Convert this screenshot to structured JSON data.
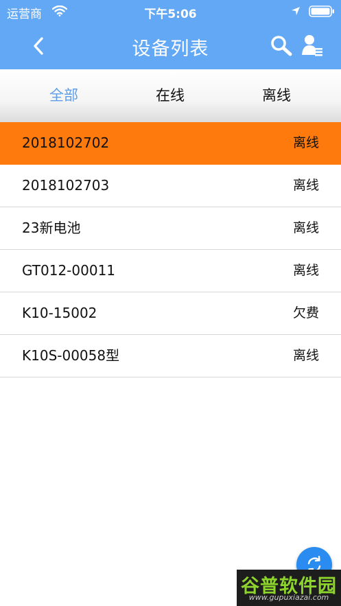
{
  "status_bar": {
    "carrier": "运营商",
    "time": "下午5:06"
  },
  "nav": {
    "title": "设备列表"
  },
  "tabs": [
    {
      "label": "全部",
      "active": true
    },
    {
      "label": "在线",
      "active": false
    },
    {
      "label": "离线",
      "active": false
    }
  ],
  "devices": [
    {
      "name": "2018102702",
      "status": "离线",
      "selected": true
    },
    {
      "name": "2018102703",
      "status": "离线",
      "selected": false
    },
    {
      "name": "23新电池",
      "status": "离线",
      "selected": false
    },
    {
      "name": "GT012-00011",
      "status": "离线",
      "selected": false
    },
    {
      "name": "K10-15002",
      "status": "欠费",
      "selected": false
    },
    {
      "name": "K10S-00058型",
      "status": "离线",
      "selected": false
    }
  ],
  "watermark": {
    "logo": "谷普软件园",
    "url": "www.gupuxiazai.com"
  },
  "colors": {
    "header": "#62a8f4",
    "active_tab": "#5d9de6",
    "selected_row": "#ff7a0d",
    "fab": "#2a8bf0"
  },
  "icons": [
    "wifi-icon",
    "location-icon",
    "battery-icon",
    "back-chevron-icon",
    "search-icon",
    "user-list-icon",
    "refresh-icon"
  ]
}
